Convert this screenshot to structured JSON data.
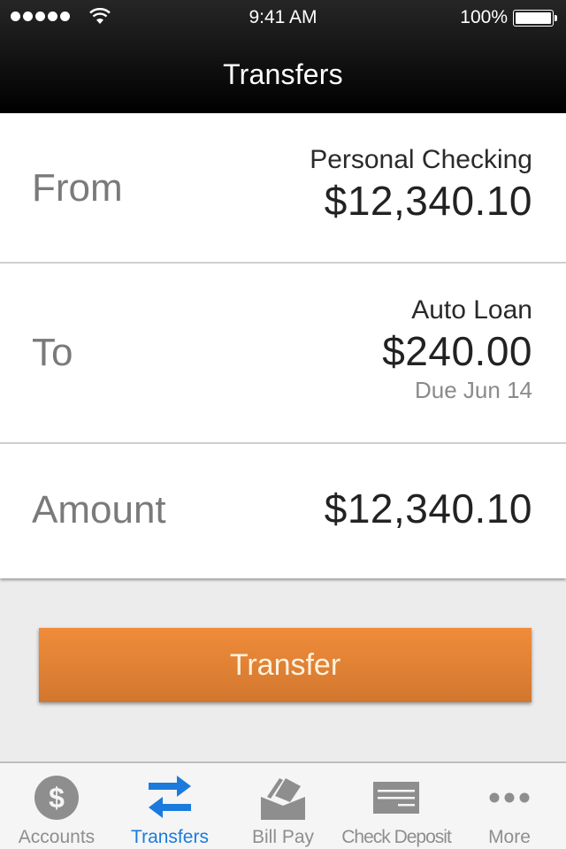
{
  "status_bar": {
    "signal_dots": 5,
    "time": "9:41 AM",
    "battery_percent": "100%",
    "battery_level": 1.0
  },
  "nav": {
    "title": "Transfers"
  },
  "transfer": {
    "from": {
      "label": "From",
      "account": "Personal Checking",
      "balance": "$12,340.10"
    },
    "to": {
      "label": "To",
      "account": "Auto Loan",
      "amount": "$240.00",
      "due": "Due Jun 14"
    },
    "amount": {
      "label": "Amount",
      "value": "$12,340.10"
    }
  },
  "actions": {
    "transfer_label": "Transfer",
    "accent_color": "#e5823a"
  },
  "tabbar": {
    "active_color": "#1a7bdc",
    "inactive_color": "#8e8e8e",
    "items": [
      {
        "label": "Accounts",
        "icon": "dollar-circle-icon",
        "active": false
      },
      {
        "label": "Transfers",
        "icon": "transfer-arrows-icon",
        "active": true
      },
      {
        "label": "Bill Pay",
        "icon": "bill-envelope-icon",
        "active": false
      },
      {
        "label": "Check Deposit",
        "icon": "check-icon",
        "active": false
      },
      {
        "label": "More",
        "icon": "more-dots-icon",
        "active": false
      }
    ]
  }
}
